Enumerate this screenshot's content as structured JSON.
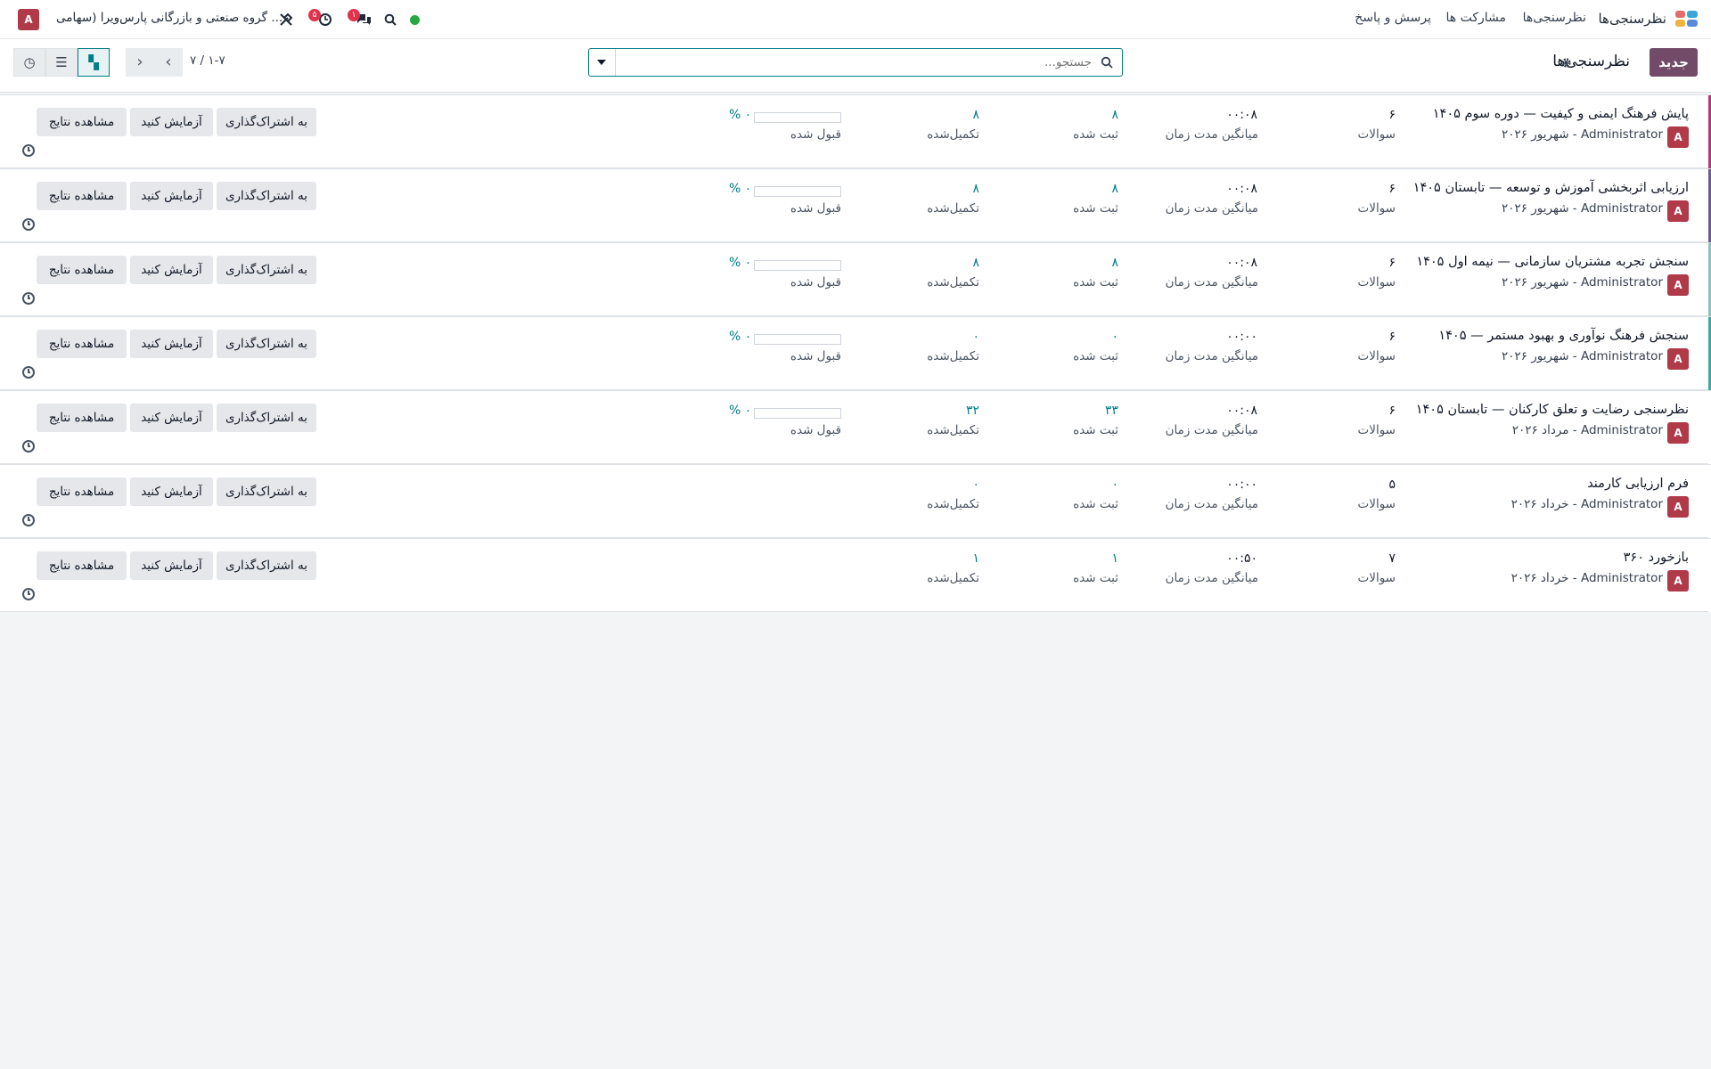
{
  "nav": {
    "app_name": "نظرسنجی‌ها",
    "menu": [
      "نظرسنجی‌ها",
      "مشارکت ها",
      "پرسش و پاسخ"
    ],
    "company": "گروه صنعتی و بازرگانی پارس‌ویرا (سهامی ...",
    "user_initial": "A",
    "chat_badge": "۱",
    "activity_badge": "۵",
    "status_color": "#28a745"
  },
  "control": {
    "new_label": "جدید",
    "breadcrumb": "نظرسنجی‌ها",
    "search_placeholder": "جستجو...",
    "pager": "۱-۷ / ۷"
  },
  "labels": {
    "questions": "سوالات",
    "avg_time": "میانگین مدت زمان",
    "registered": "ثبت شده",
    "completed": "تکمیل‌شده",
    "passed": "قبول شده",
    "share": "به اشتراک‌گذاری",
    "test": "آزمایش کنید",
    "results": "مشاهده نتایج"
  },
  "surveys": [
    {
      "title": "پایش فرهنگ ایمنی و کیفیت — دوره سوم ۱۴۰۵",
      "subtitle": "Administrator - شهریور ۲۰۲۶",
      "questions": "۶",
      "avg_time": "۰۰:۰۸",
      "registered": "۸",
      "completed": "۸",
      "pass_rate": "۰ %",
      "pass_fraction": 0,
      "show_pass": true,
      "stripe": "#b03a7b"
    },
    {
      "title": "ارزیابی اثربخشی آموزش و توسعه — تابستان ۱۴۰۵",
      "subtitle": "Administrator - شهریور ۲۰۲۶",
      "questions": "۶",
      "avg_time": "۰۰:۰۸",
      "registered": "۸",
      "completed": "۸",
      "pass_rate": "۰ %",
      "pass_fraction": 0,
      "show_pass": true,
      "stripe": "#6b5b95"
    },
    {
      "title": "سنجش تجربه مشتریان سازمانی — نیمه اول ۱۴۰۵",
      "subtitle": "Administrator - شهریور ۲۰۲۶",
      "questions": "۶",
      "avg_time": "۰۰:۰۸",
      "registered": "۸",
      "completed": "۸",
      "pass_rate": "۰ %",
      "pass_fraction": 0,
      "show_pass": true,
      "stripe": "#8fbfbf"
    },
    {
      "title": "سنجش فرهنگ نوآوری و بهبود مستمر — ۱۴۰۵",
      "subtitle": "Administrator - شهریور ۲۰۲۶",
      "questions": "۶",
      "avg_time": "۰۰:۰۰",
      "registered": "۰",
      "completed": "۰",
      "pass_rate": "۰ %",
      "pass_fraction": 0,
      "show_pass": true,
      "stripe": "#3fa9a0"
    },
    {
      "title": "نظرسنجی رضایت و تعلق کارکنان — تابستان ۱۴۰۵",
      "subtitle": "Administrator - مرداد ۲۰۲۶",
      "questions": "۶",
      "avg_time": "۰۰:۰۸",
      "registered": "۳۳",
      "completed": "۳۲",
      "pass_rate": "۰ %",
      "pass_fraction": 0,
      "show_pass": true,
      "stripe": "#ffffff"
    },
    {
      "title": "فرم ارزیابی کارمند",
      "subtitle": "Administrator - خرداد ۲۰۲۶",
      "questions": "۵",
      "avg_time": "۰۰:۰۰",
      "registered": "۰",
      "completed": "۰",
      "pass_rate": "",
      "pass_fraction": 0,
      "show_pass": false,
      "stripe": "#ffffff"
    },
    {
      "title": "بازخورد ۳۶۰",
      "subtitle": "Administrator - خرداد ۲۰۲۶",
      "questions": "۷",
      "avg_time": "۰۰:۵۰",
      "registered": "۱",
      "completed": "۱",
      "pass_rate": "",
      "pass_fraction": 0,
      "show_pass": false,
      "stripe": "#ffffff"
    }
  ]
}
